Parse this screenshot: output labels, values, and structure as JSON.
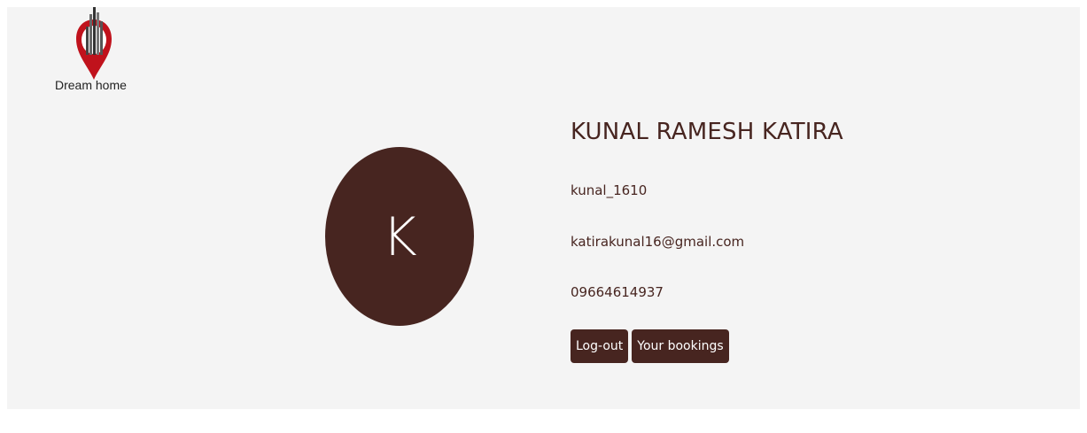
{
  "logo": {
    "text": "Dream home",
    "icon": "location-pin-building-icon",
    "colors": {
      "pin": "#c0121c",
      "buildings": "#5a5a5a"
    }
  },
  "profile": {
    "avatar_letter": "K",
    "name": "KUNAL RAMESH KATIRA",
    "username": "kunal_1610",
    "email": "katirakunal16@gmail.com",
    "phone": "09664614937"
  },
  "actions": {
    "logout_label": "Log-out",
    "bookings_label": "Your bookings"
  },
  "colors": {
    "accent": "#472520",
    "background": "#f4f4f4"
  }
}
